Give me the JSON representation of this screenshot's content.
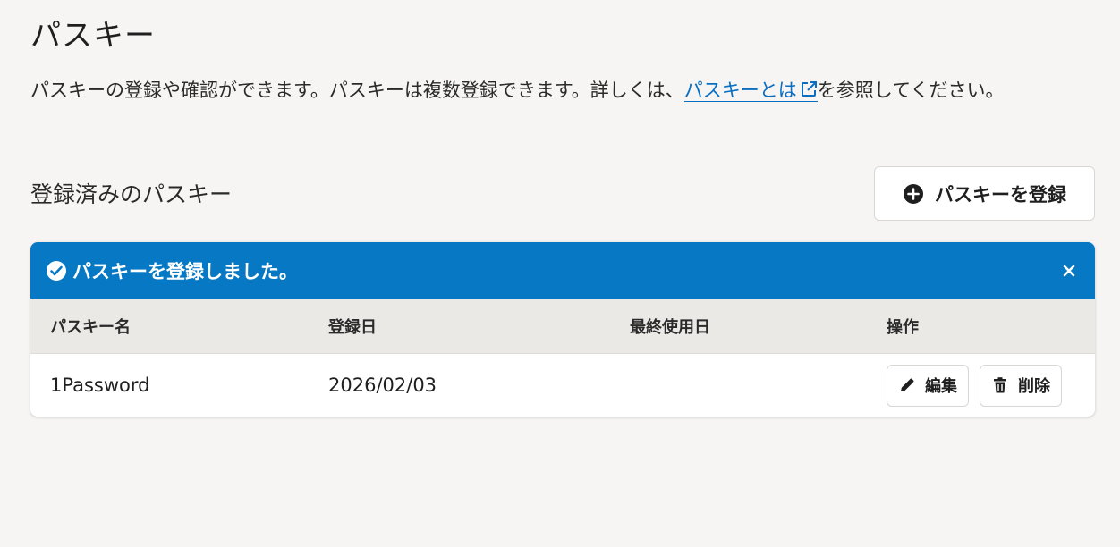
{
  "page": {
    "title": "パスキー",
    "description_before": "パスキーの登録や確認ができます。パスキーは複数登録できます。詳しくは、",
    "description_link": "パスキーとは",
    "description_after": "を参照してください。"
  },
  "section": {
    "heading": "登録済みのパスキー",
    "register_button_label": "パスキーを登録"
  },
  "banner": {
    "message": "パスキーを登録しました。",
    "color": "#0678c4"
  },
  "table": {
    "headers": [
      "パスキー名",
      "登録日",
      "最終使用日",
      "操作"
    ],
    "rows": [
      {
        "name": "1Password",
        "registered": "2026/02/03",
        "last_used": ""
      }
    ]
  },
  "actions": {
    "edit_label": "編集",
    "delete_label": "削除"
  },
  "colors": {
    "link": "#0a6fc2",
    "background": "#f6f5f4"
  },
  "icons": [
    "external-link-icon",
    "plus-circle-icon",
    "check-circle-icon",
    "close-icon",
    "pencil-icon",
    "trash-icon"
  ]
}
